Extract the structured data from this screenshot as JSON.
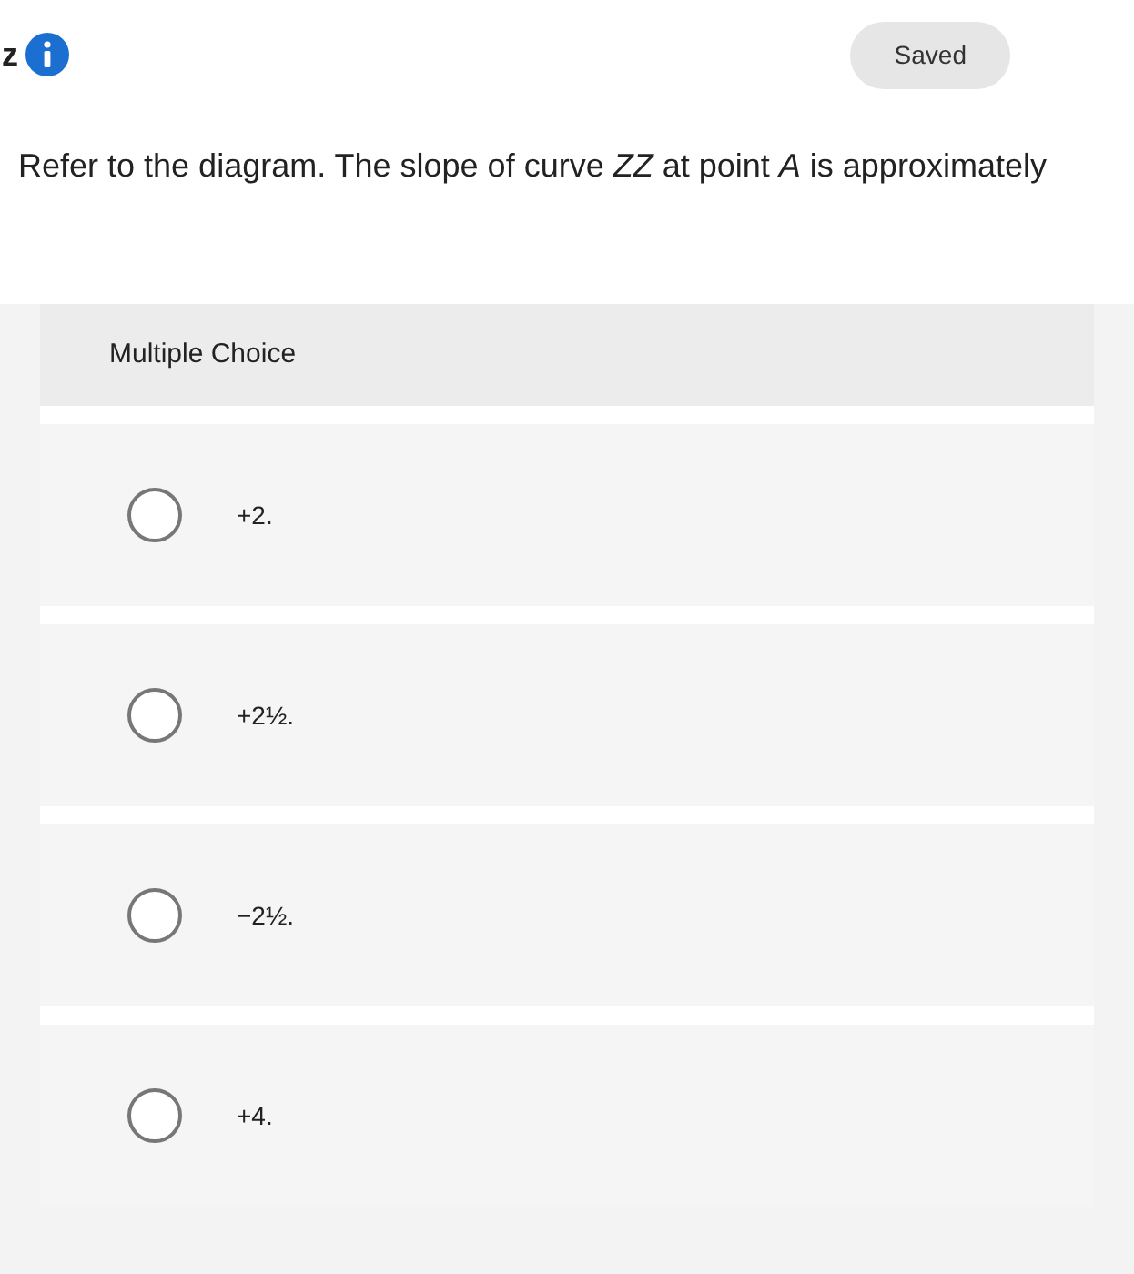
{
  "top_bar": {
    "fragment": "z",
    "saved_label": "Saved"
  },
  "question": "Refer to the diagram. The slope of curve *ZZ* at point *A* is approximately",
  "card": {
    "heading": "Multiple Choice",
    "options": [
      {
        "label": "+2.",
        "selected": false
      },
      {
        "label": "+2½.",
        "selected": false
      },
      {
        "label": "−2½.",
        "selected": false
      },
      {
        "label": "+4.",
        "selected": false
      }
    ]
  }
}
